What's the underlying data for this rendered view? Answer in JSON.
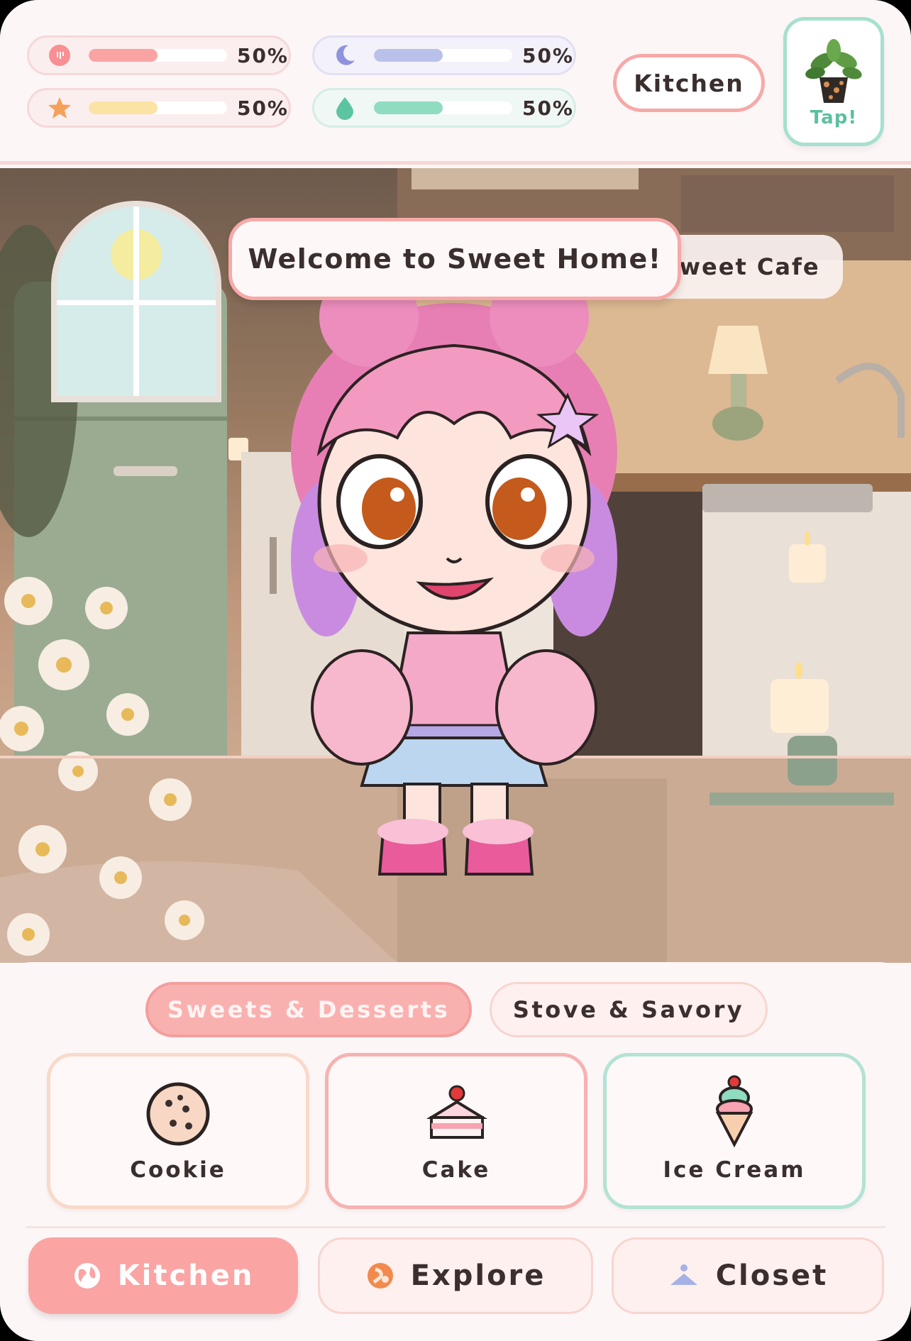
{
  "stats": [
    {
      "id": "hunger",
      "icon": "hunger-icon",
      "value_pct": 50,
      "label": "50%",
      "color": "#f9a3a3"
    },
    {
      "id": "energy",
      "icon": "moon-icon",
      "value_pct": 50,
      "label": "50%",
      "color": "#b9c1eb"
    },
    {
      "id": "fun",
      "icon": "star-icon",
      "value_pct": 50,
      "label": "50%",
      "color": "#fbe3a6"
    },
    {
      "id": "hygiene",
      "icon": "water-drop-icon",
      "value_pct": 50,
      "label": "50%",
      "color": "#8fdcc0"
    }
  ],
  "header": {
    "room_name": "Kitchen",
    "plant_button_label": "Tap!"
  },
  "scene": {
    "welcome_message": "Welcome to Sweet Home!",
    "location_tag": "Sweet Cafe"
  },
  "categories": {
    "active": "Sweets & Desserts",
    "tabs": [
      {
        "label": "Sweets & Desserts",
        "active": true
      },
      {
        "label": "Stove & Savory",
        "active": false
      }
    ]
  },
  "items": [
    {
      "label": "Cookie",
      "icon": "cookie-icon"
    },
    {
      "label": "Cake",
      "icon": "cake-icon"
    },
    {
      "label": "Ice Cream",
      "icon": "ice-cream-icon"
    }
  ],
  "nav": [
    {
      "label": "Kitchen",
      "icon": "globe-icon",
      "active": true
    },
    {
      "label": "Explore",
      "icon": "compass-icon",
      "active": false
    },
    {
      "label": "Closet",
      "icon": "hanger-icon",
      "active": false
    }
  ],
  "colors": {
    "accent_pink": "#fba4a4",
    "mint": "#a6e0cf",
    "background": "#fdf6f7",
    "text": "#3a2e2e"
  }
}
